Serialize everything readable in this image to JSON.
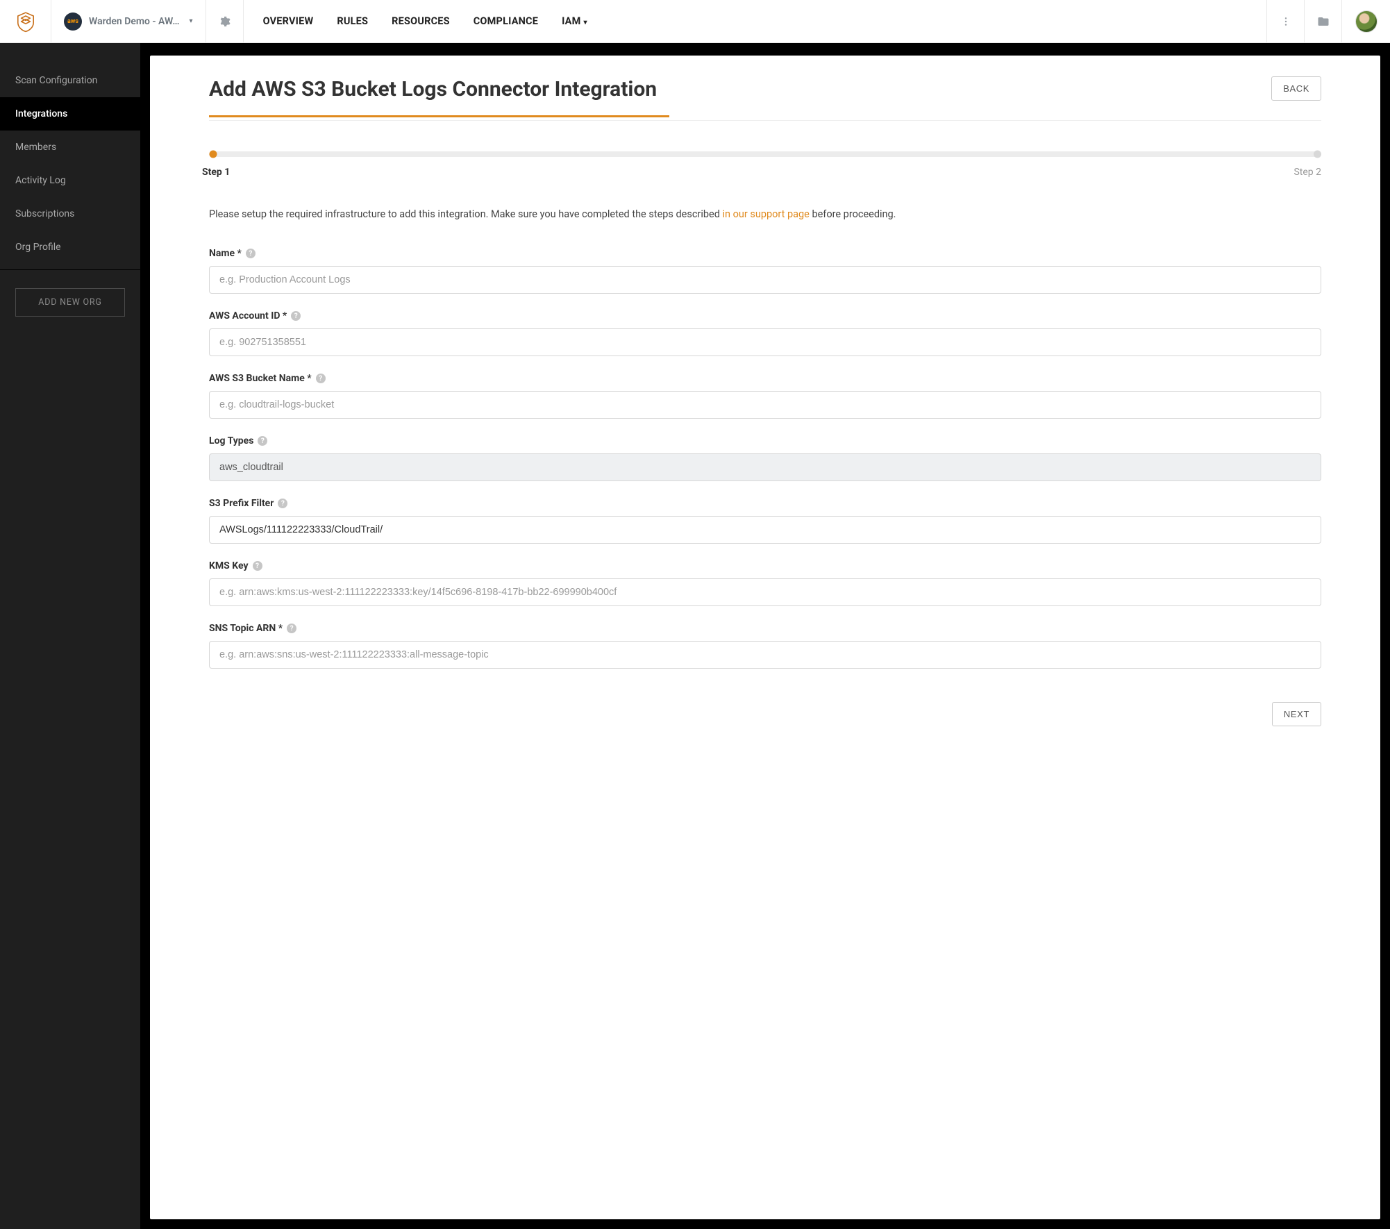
{
  "header": {
    "org_badge": "aws",
    "org_name": "Warden Demo - AW…",
    "nav": {
      "overview": "OVERVIEW",
      "rules": "RULES",
      "resources": "RESOURCES",
      "compliance": "COMPLIANCE",
      "iam": "IAM"
    }
  },
  "sidebar": {
    "items": [
      "Scan Configuration",
      "Integrations",
      "Members",
      "Activity Log",
      "Subscriptions",
      "Org Profile"
    ],
    "active_index": 1,
    "add_org": "ADD NEW ORG"
  },
  "page": {
    "title": "Add AWS S3 Bucket Logs Connector Integration",
    "back": "BACK",
    "step_active": "Step 1",
    "step_inactive": "Step 2",
    "intro_before": "Please setup the required infrastructure to add this integration. Make sure you have completed the steps described ",
    "intro_link": "in our support page",
    "intro_after": " before proceeding.",
    "next": "NEXT"
  },
  "form": {
    "name": {
      "label": "Name *",
      "placeholder": "e.g. Production Account Logs",
      "value": ""
    },
    "account_id": {
      "label": "AWS Account ID *",
      "placeholder": "e.g. 902751358551",
      "value": ""
    },
    "bucket": {
      "label": "AWS S3 Bucket Name *",
      "placeholder": "e.g. cloudtrail-logs-bucket",
      "value": ""
    },
    "log_types": {
      "label": "Log Types",
      "value": "aws_cloudtrail"
    },
    "prefix": {
      "label": "S3 Prefix Filter",
      "placeholder": "",
      "value": "AWSLogs/111122223333/CloudTrail/"
    },
    "kms": {
      "label": "KMS Key",
      "placeholder": "e.g. arn:aws:kms:us-west-2:111122223333:key/14f5c696-8198-417b-bb22-699990b400cf",
      "value": ""
    },
    "sns": {
      "label": "SNS Topic ARN *",
      "placeholder": "e.g. arn:aws:sns:us-west-2:111122223333:all-message-topic",
      "value": ""
    }
  }
}
